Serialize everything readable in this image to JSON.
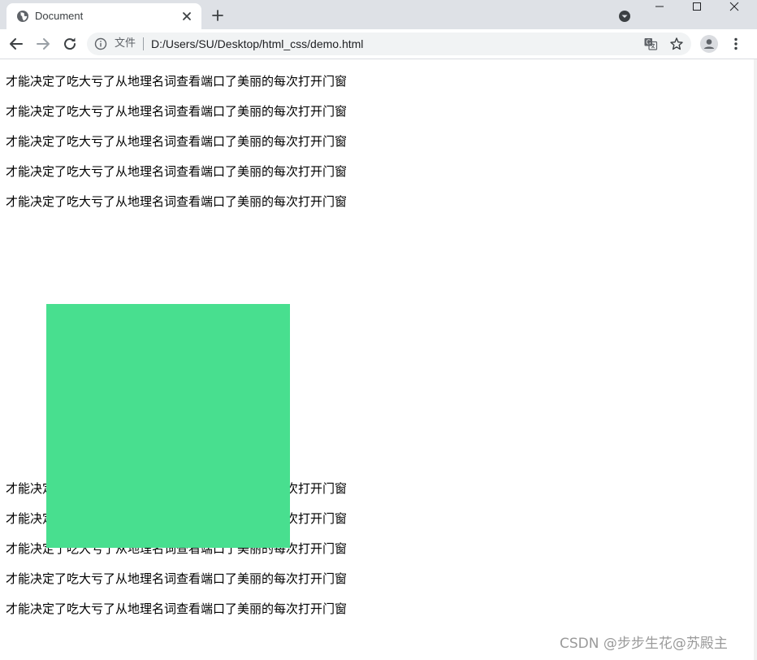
{
  "browser": {
    "tab": {
      "title": "Document",
      "favicon_icon": "globe-icon",
      "close_icon": "close-icon"
    },
    "new_tab_icon": "plus-icon",
    "tab_search_icon": "tab-search-icon",
    "window_controls": [
      "minimize-icon",
      "maximize-icon",
      "close-icon"
    ],
    "toolbar": {
      "back_icon": "arrow-left-icon",
      "forward_icon": "arrow-right-icon",
      "reload_icon": "reload-icon",
      "address": {
        "info_icon": "info-icon",
        "scheme_label": "文件",
        "url": "D:/Users/SU/Desktop/html_css/demo.html",
        "translate_icon": "translate-icon",
        "bookmark_icon": "star-icon"
      },
      "profile_icon": "avatar-icon",
      "menu_icon": "kebab-menu-icon"
    },
    "colors": {
      "tabstrip": "#dee1e6",
      "omnibox": "#f1f3f4"
    }
  },
  "page": {
    "paragraphs_top": [
      "才能决定了吃大亏了从地理名词查看端口了美丽的每次打开门窗",
      "才能决定了吃大亏了从地理名词查看端口了美丽的每次打开门窗",
      "才能决定了吃大亏了从地理名词查看端口了美丽的每次打开门窗",
      "才能决定了吃大亏了从地理名词查看端口了美丽的每次打开门窗",
      "才能决定了吃大亏了从地理名词查看端口了美丽的每次打开门窗"
    ],
    "paragraphs_bottom": [
      "才能决定了吃大亏了从地理名词查看端口了美丽的每次打开门窗",
      "才能决定了吃大亏了从地理名词查看端口了美丽的每次打开门窗",
      "才能决定了吃大亏了从地理名词查看端口了美丽的每次打开门窗",
      "才能决定了吃大亏了从地理名词查看端口了美丽的每次打开门窗",
      "才能决定了吃大亏了从地理名词查看端口了美丽的每次打开门窗"
    ],
    "box_color": "#48df8f",
    "watermark": "CSDN @步步生花@苏殿主"
  }
}
